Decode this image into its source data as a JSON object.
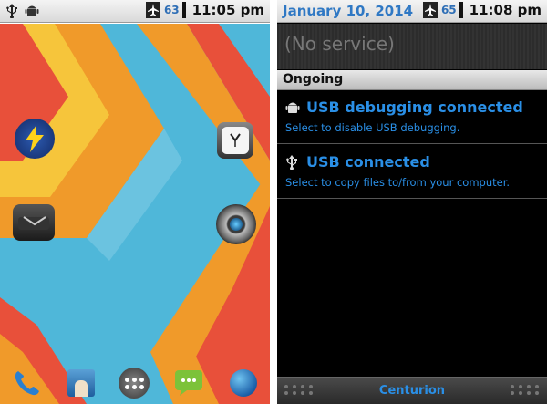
{
  "status_bar": {
    "left_screen": {
      "battery_level": "63",
      "time": "11:05 pm"
    },
    "right_screen": {
      "date": "January 10, 2014",
      "battery_level": "65",
      "time": "11:08 pm"
    },
    "icons": [
      "usb-icon",
      "android-icon",
      "airplane-mode-icon",
      "battery-icon"
    ]
  },
  "home_screen": {
    "wallpaper_colors": {
      "blue": "#4fb7d9",
      "orange": "#f09a2a",
      "red": "#e8503a",
      "yellow": "#f6c53b"
    },
    "shortcuts": [
      "flash-app-icon",
      "clock-widget-icon",
      "dock-toggle-icon",
      "camera-lens-icon"
    ],
    "dock": [
      "phone-icon",
      "contacts-icon",
      "app-drawer-icon",
      "messaging-icon",
      "browser-icon"
    ]
  },
  "notification_shade": {
    "carrier": "(No service)",
    "section_title": "Ongoing",
    "notifications": [
      {
        "icon": "android-icon",
        "title": "USB debugging connected",
        "subtitle": "Select to disable USB debugging."
      },
      {
        "icon": "usb-icon",
        "title": "USB connected",
        "subtitle": "Select to copy files to/from your computer."
      }
    ],
    "bottom_label": "Centurion",
    "accent_color": "#2a8fe6"
  }
}
